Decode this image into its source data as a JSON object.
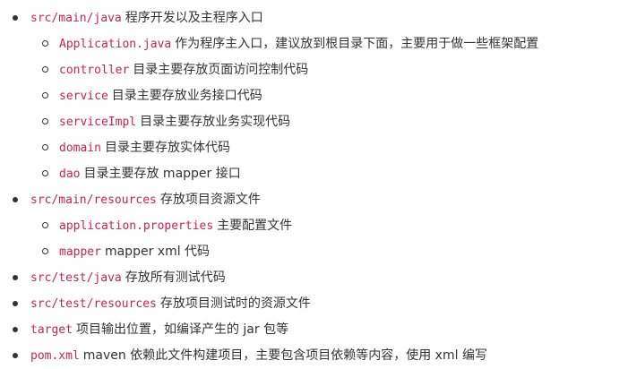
{
  "items": [
    {
      "code": "src/main/java",
      "text": "程序开发以及主程序入口",
      "children": [
        {
          "code": "Application.java",
          "text": "作为程序主入口，建议放到根目录下面，主要用于做一些框架配置"
        },
        {
          "code": "controller",
          "text": "目录主要存放页面访问控制代码"
        },
        {
          "code": "service",
          "text": "目录主要存放业务接口代码"
        },
        {
          "code": "serviceImpl",
          "text": "目录主要存放业务实现代码"
        },
        {
          "code": "domain",
          "text": "目录主要存放实体代码"
        },
        {
          "code": "dao",
          "text": "目录主要存放 mapper 接口"
        }
      ]
    },
    {
      "code": "src/main/resources",
      "text": "存放项目资源文件",
      "children": [
        {
          "code": "application.properties",
          "text": "主要配置文件"
        },
        {
          "code": "mapper",
          "text": "mapper xml 代码"
        }
      ]
    },
    {
      "code": "src/test/java",
      "text": "存放所有测试代码",
      "children": []
    },
    {
      "code": "src/test/resources",
      "text": "存放项目测试时的资源文件",
      "children": []
    },
    {
      "code": "target",
      "text": "项目输出位置，如编译产生的 jar 包等",
      "children": []
    },
    {
      "code": "pom.xml",
      "text": "maven 依赖此文件构建项目，主要包含项目依赖等内容，使用 xml 编写",
      "children": []
    }
  ]
}
